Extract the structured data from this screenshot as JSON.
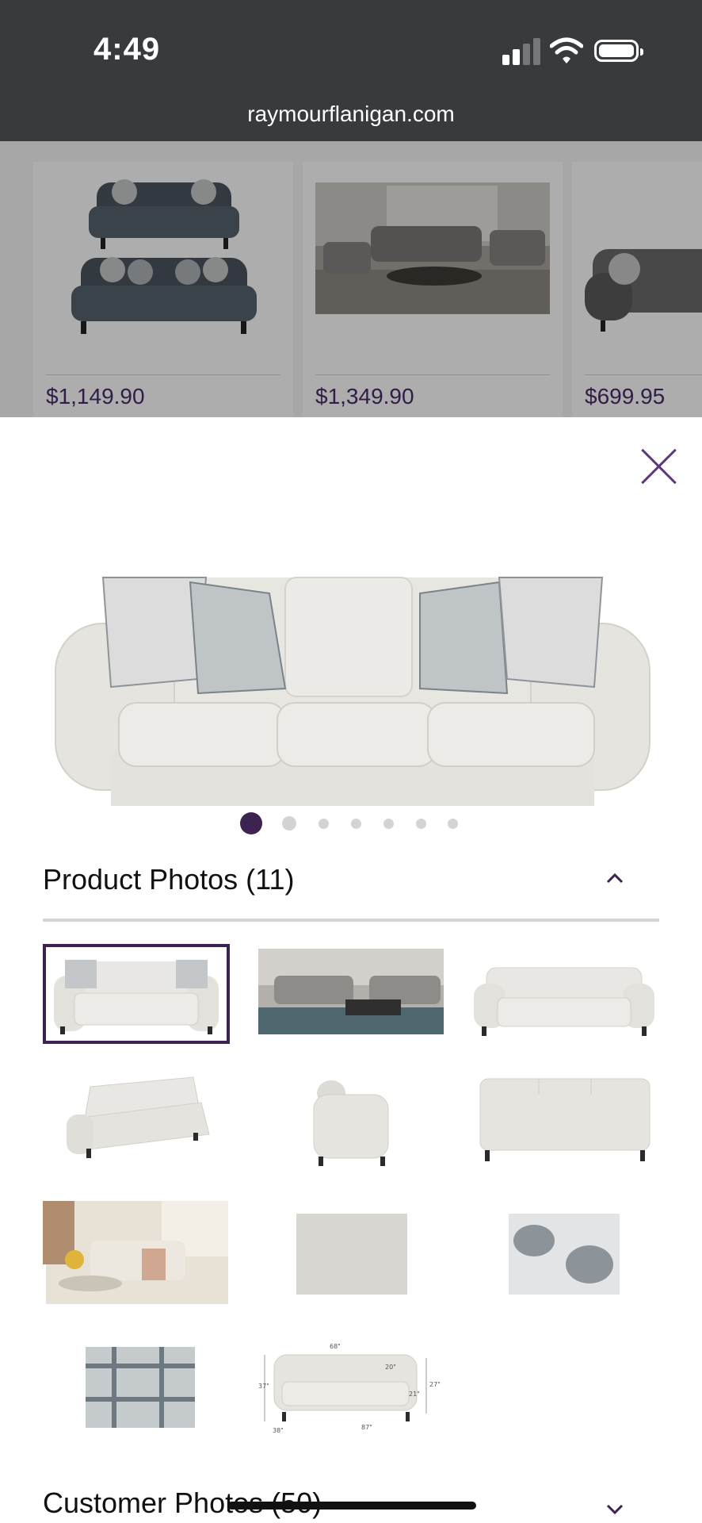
{
  "status_bar": {
    "time": "4:49"
  },
  "browser": {
    "url": "raymourflanigan.com"
  },
  "recommendations": [
    {
      "price": "$1,149.90"
    },
    {
      "price": "$1,349.90"
    },
    {
      "price": "$699.95"
    }
  ],
  "gallery": {
    "carousel": {
      "count": 7,
      "active_index": 0
    },
    "product_photos": {
      "title": "Product Photos (11)",
      "expanded": true,
      "selected_index": 0
    },
    "customer_photos": {
      "title": "Customer Photos (50)",
      "expanded": false
    },
    "dimensions": {
      "width": "68\"",
      "height_left": "37\"",
      "seat": "20\"",
      "depth_back": "21\"",
      "height_right": "27\"",
      "depth": "38\"",
      "length": "87\""
    }
  },
  "colors": {
    "accent": "#3d2352",
    "price": "#4a2c6b",
    "status_bar": "#383b3e"
  }
}
